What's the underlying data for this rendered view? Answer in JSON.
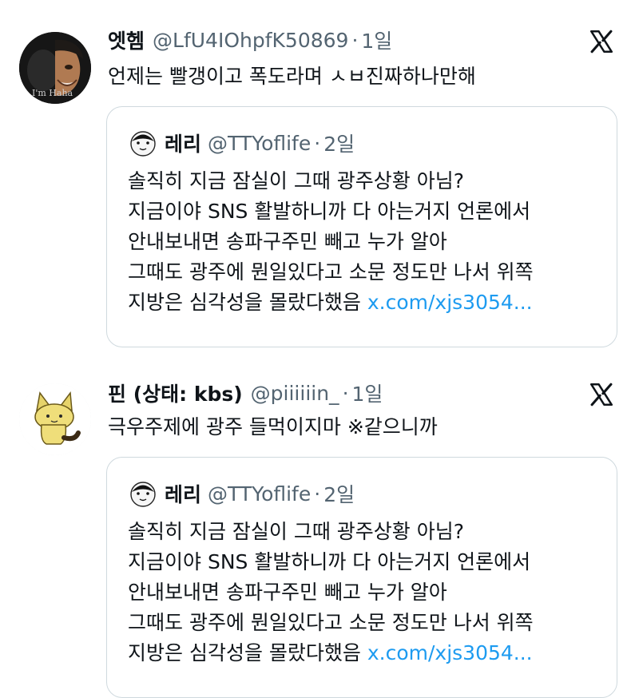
{
  "tweets": [
    {
      "author_name": "엣헴",
      "handle": "@LfU4IOhpfK50869",
      "separator": "·",
      "time": "1일",
      "avatar_caption": "I'm Haha",
      "text": "언제는 빨갱이고 폭도라며 ㅅㅂ진짜하나만해",
      "quote": {
        "author_name": "레리",
        "handle": "@TTYoflife",
        "separator": "·",
        "time": "2일",
        "lines": [
          "솔직히 지금 잠실이 그때 광주상황 아님?",
          "지금이야 SNS 활발하니까 다 아는거지 언론에서",
          "안내보내면 송파구주민 빼고 누가 알아",
          "그때도 광주에 뭔일있다고 소문 정도만 나서 위쪽"
        ],
        "last_line_text": "지방은 심각성을 몰랐다했음 ",
        "link": "x.com/xjs3054..."
      }
    },
    {
      "author_name": "핀 (상태: kbs)",
      "handle": "@piiiiiin_",
      "separator": "·",
      "time": "1일",
      "text": "극우주제에 광주 들먹이지마 ※같으니까",
      "quote": {
        "author_name": "레리",
        "handle": "@TTYoflife",
        "separator": "·",
        "time": "2일",
        "lines": [
          "솔직히 지금 잠실이 그때 광주상황 아님?",
          "지금이야 SNS 활발하니까 다 아는거지 언론에서",
          "안내보내면 송파구주민 빼고 누가 알아",
          "그때도 광주에 뭔일있다고 소문 정도만 나서 위쪽"
        ],
        "last_line_text": "지방은 심각성을 몰랐다했음 ",
        "link": "x.com/xjs3054..."
      }
    }
  ],
  "icons": {
    "platform": "x-logo-icon"
  },
  "colors": {
    "text": "#0f1419",
    "secondary": "#536471",
    "link": "#1d9bf0",
    "border": "#cfd9de"
  }
}
